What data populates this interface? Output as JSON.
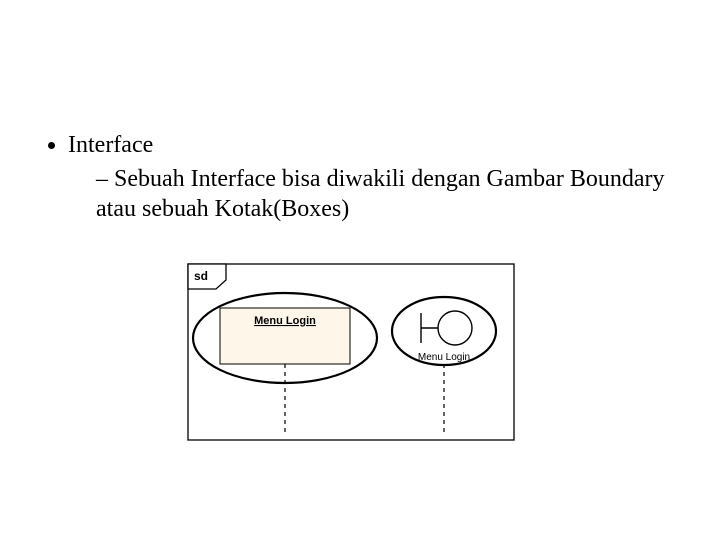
{
  "bullets": {
    "l1": "Interface",
    "l2": "Sebuah Interface bisa diwakili dengan Gambar Boundary atau sebuah Kotak(Boxes)"
  },
  "diagram": {
    "frame_label": "sd",
    "box_label": "Menu Login",
    "boundary_label": "Menu Login"
  }
}
